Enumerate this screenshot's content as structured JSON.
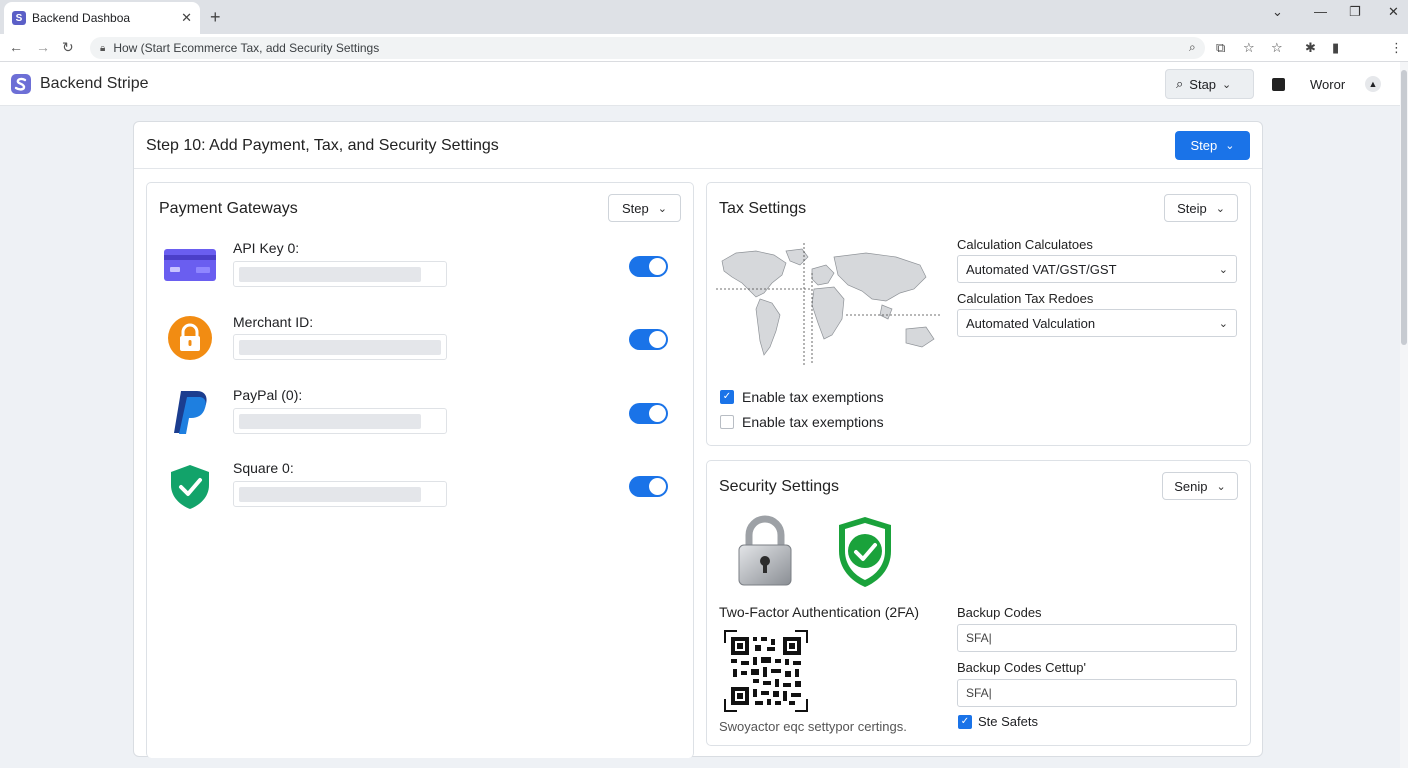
{
  "browser": {
    "tab_title": "Backend Dashboa",
    "tab_close": "✕",
    "new_tab": "+",
    "address": "How (Start Ecommerce Tax, add Security Settings",
    "window_controls": [
      "⌄",
      "—",
      "❐",
      "✕"
    ]
  },
  "app": {
    "name": "Backend Stripe",
    "header_dropdown_label": "Stap",
    "header_text": "Woror"
  },
  "main": {
    "title": "Step 10: Add Payment, Tax, and Security Settings",
    "primary_button": "Step"
  },
  "payment": {
    "title": "Payment Gateways",
    "dropdown": "Step",
    "gateways": [
      {
        "label": "API Key  0:",
        "icon": "credit-card-icon",
        "enabled": true
      },
      {
        "label": "Merchant ID:",
        "icon": "padlock-icon",
        "enabled": true
      },
      {
        "label": "PayPal (0):",
        "icon": "paypal-icon",
        "enabled": true
      },
      {
        "label": "Square  0:",
        "icon": "shield-check-icon",
        "enabled": true
      }
    ]
  },
  "tax": {
    "title": "Tax Settings",
    "dropdown": "Steip",
    "calc_label": "Calculation Calculatoes",
    "calc_value": "Automated VAT/GST/GST",
    "rates_label": "Calculation Tax Redoes",
    "rates_value": "Automated Valculation",
    "exemption1": {
      "label": "Enable tax exemptions",
      "checked": true
    },
    "exemption2": {
      "label": "Enable tax exemptions",
      "checked": false
    }
  },
  "security": {
    "title": "Security Settings",
    "dropdown": "Senip",
    "twofa_label": "Two-Factor Authentication (2FA)",
    "twofa_caption": "Swoyactor eqc settypor certings.",
    "backup_label": "Backup Codes",
    "backup_value": "SFA|",
    "backup_setup_label": "Backup Codes Cettup'",
    "backup_setup_value": "SFA|",
    "safe_label": "Ste Safets",
    "safe_checked": true
  },
  "colors": {
    "primary": "#1a73e8",
    "brand": "#5b5fc7",
    "success": "#16a34a"
  }
}
